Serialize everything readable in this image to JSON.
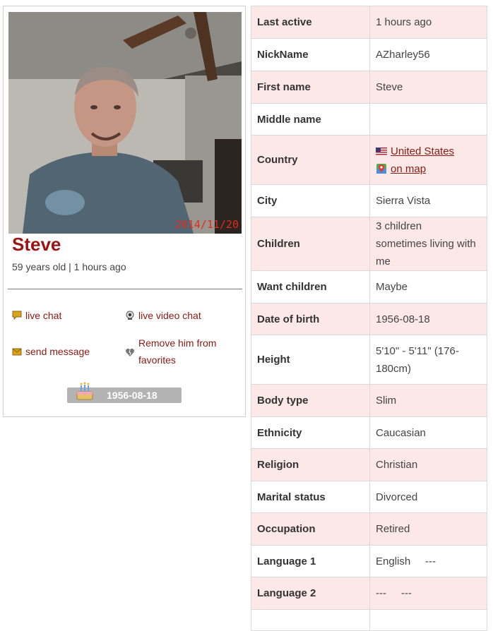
{
  "profile": {
    "photo_stamp": "2014/11/20",
    "name": "Steve",
    "age_line": "59 years old | 1 hours ago",
    "birthday_badge": "1956-08-18",
    "actions": {
      "live_chat": "live chat",
      "live_video_chat": "live video chat",
      "send_message": "send message",
      "remove_favorite": "Remove him from favorites"
    },
    "icons": {
      "live_chat": "speech-bubble-icon",
      "live_video_chat": "webcam-icon",
      "send_message": "envelope-icon",
      "remove_favorite": "broken-heart-icon",
      "birthday": "birthday-cake-icon"
    }
  },
  "details": [
    {
      "label": "Last active",
      "value": "1 hours ago"
    },
    {
      "label": "NickName",
      "value": "AZharley56"
    },
    {
      "label": "First name",
      "value": "Steve"
    },
    {
      "label": "Middle name",
      "value": ""
    },
    {
      "label": "Country",
      "value": "United States",
      "link2": "on map"
    },
    {
      "label": "City",
      "value": "Sierra Vista"
    },
    {
      "label": "Children",
      "value": "3 children   sometimes living with me"
    },
    {
      "label": "Want children",
      "value": "Maybe"
    },
    {
      "label": "Date of birth",
      "value": "1956-08-18"
    },
    {
      "label": "Height",
      "value": "5'10\" - 5'11\" (176-180cm)"
    },
    {
      "label": "Body type",
      "value": "Slim"
    },
    {
      "label": "Ethnicity",
      "value": "Caucasian"
    },
    {
      "label": "Religion",
      "value": "Christian"
    },
    {
      "label": "Marital status",
      "value": "Divorced"
    },
    {
      "label": "Occupation",
      "value": "Retired"
    },
    {
      "label": "Language 1",
      "value": "English     ---"
    },
    {
      "label": "Language 2",
      "value": "---     ---"
    },
    {
      "label": "",
      "value": ""
    }
  ],
  "colors": {
    "accent": "#9b1313",
    "link": "#8b1a12",
    "row_pink": "#fde8e8",
    "badge_gray": "#b3b3b3",
    "stamp_red": "#e22b1a"
  }
}
